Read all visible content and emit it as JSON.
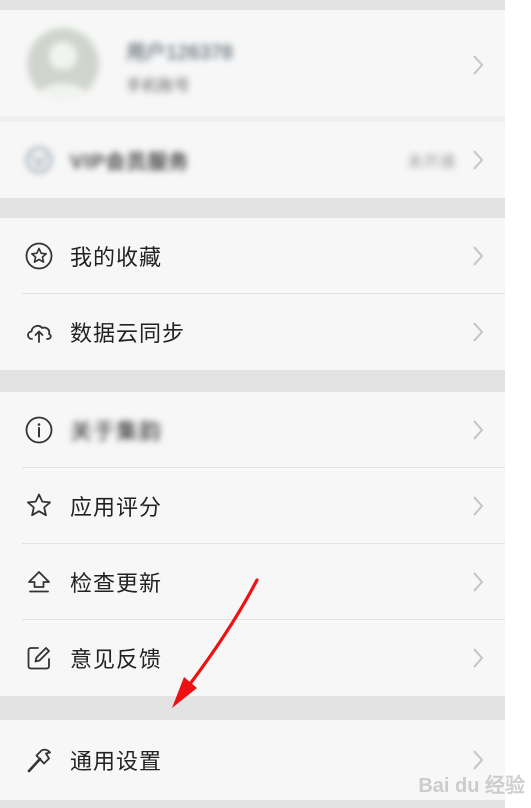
{
  "profile": {
    "username": "用户126378",
    "subtitle": "手机账号"
  },
  "vip": {
    "label": "VIP会员服务",
    "status": "未开通"
  },
  "menu": {
    "favorites": "我的收藏",
    "cloud_sync": "数据云同步",
    "about": "关于集韵",
    "rate_app": "应用评分",
    "check_update": "检查更新",
    "feedback": "意见反馈",
    "general_settings": "通用设置"
  },
  "watermark": "Bai du 经验",
  "colors": {
    "background": "#f7f7f7",
    "separator": "#e3e3e3",
    "annotation_arrow": "#ee1111"
  },
  "icons": {
    "favorites": "star-circle-icon",
    "cloud_sync": "cloud-sync-icon",
    "about": "info-icon",
    "rate_app": "star-icon",
    "check_update": "upload-arrow-icon",
    "feedback": "edit-icon",
    "general_settings": "hammer-icon"
  }
}
